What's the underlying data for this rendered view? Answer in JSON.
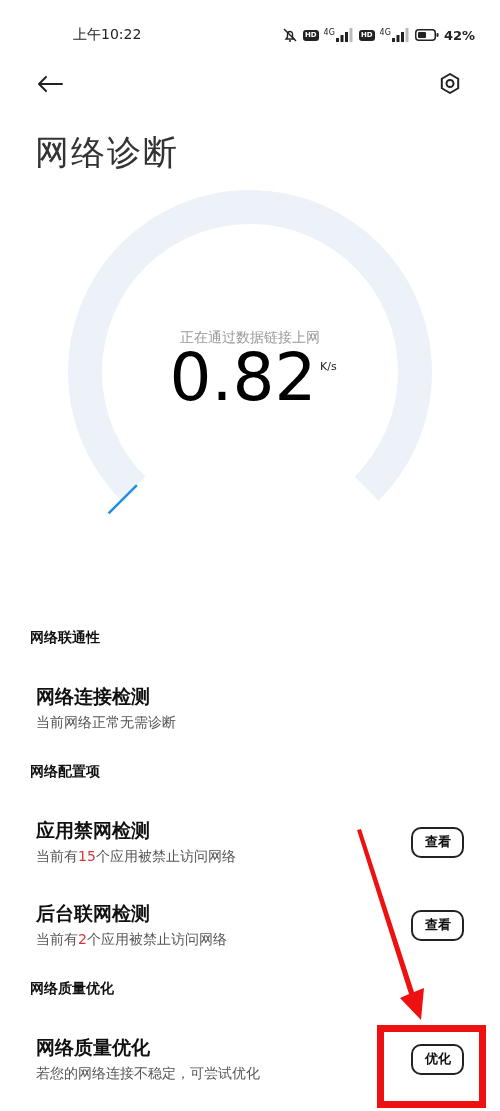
{
  "status_bar": {
    "time": "上午10:22",
    "icons": [
      {
        "kind": "bell-muted"
      },
      {
        "kind": "hd",
        "label": "HD"
      },
      {
        "kind": "signal",
        "label": "4G"
      },
      {
        "kind": "hd",
        "label": "HD"
      },
      {
        "kind": "signal",
        "label": "4G"
      },
      {
        "kind": "battery"
      }
    ],
    "battery_text": "42%"
  },
  "title": "网络诊断",
  "gauge": {
    "caption": "正在通过数据链接上网",
    "value": "0.82",
    "unit": "K/s"
  },
  "sections": [
    {
      "heading": "网络联通性",
      "items": [
        {
          "title": "网络连接检测",
          "subtitle": [
            {
              "text": "当前网络正常无需诊断",
              "highlight": false
            }
          ]
        }
      ]
    },
    {
      "heading": "网络配置项",
      "items": [
        {
          "title": "应用禁网检测",
          "subtitle": [
            {
              "text": "当前有",
              "highlight": false
            },
            {
              "text": "15",
              "highlight": true
            },
            {
              "text": "个应用被禁止访问网络",
              "highlight": false
            }
          ],
          "button": "查看"
        },
        {
          "title": "后台联网检测",
          "subtitle": [
            {
              "text": "当前有",
              "highlight": false
            },
            {
              "text": "2",
              "highlight": true
            },
            {
              "text": "个应用被禁止访问网络",
              "highlight": false
            }
          ],
          "button": "查看"
        }
      ]
    },
    {
      "heading": "网络质量优化",
      "items": [
        {
          "title": "网络质量优化",
          "subtitle": [
            {
              "text": "若您的网络连接不稳定，可尝试优化",
              "highlight": false
            }
          ],
          "button": "优化"
        }
      ]
    }
  ],
  "annotations": {
    "arrow": true,
    "highlight_box": true
  }
}
